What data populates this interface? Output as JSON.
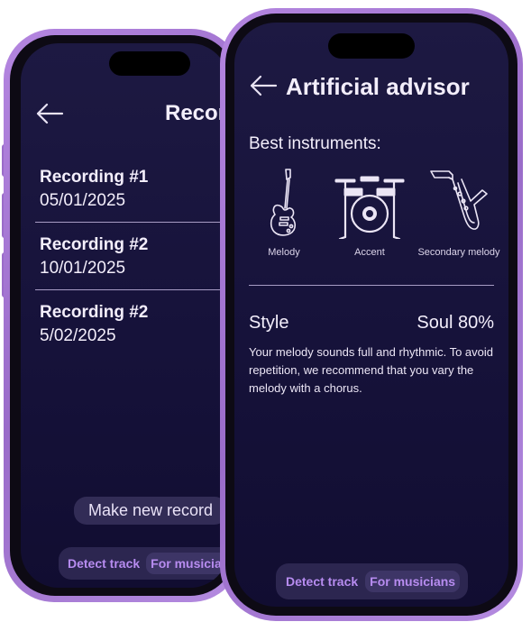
{
  "recordings_screen": {
    "title": "Recordings",
    "items": [
      {
        "title": "Recording #1",
        "date": "05/01/2025"
      },
      {
        "title": "Recording #2",
        "date": "10/01/2025"
      },
      {
        "title": "Recording #2",
        "date": "5/02/2025"
      }
    ],
    "new_record_button": "Make new record",
    "nav": {
      "detect": "Detect track",
      "musicians": "For musicians"
    }
  },
  "advisor_screen": {
    "title": "Artificial advisor",
    "section_label": "Best instruments:",
    "instruments": [
      {
        "icon": "electric-guitar-icon",
        "label": "Melody"
      },
      {
        "icon": "drum-kit-icon",
        "label": "Accent"
      },
      {
        "icon": "saxophone-icon",
        "label": "Secondary melody"
      }
    ],
    "style_label": "Style",
    "style_value": "Soul 80%",
    "description": "Your melody sounds full and rhythmic. To avoid repetition, we recommend that you vary the melody with a chorus.",
    "nav": {
      "detect": "Detect track",
      "musicians": "For musicians"
    }
  },
  "colors": {
    "frame": "#9a6cc9",
    "screen_bg": "#1b1740",
    "accent": "#b78cf0",
    "pill_bg": "#322c56"
  }
}
